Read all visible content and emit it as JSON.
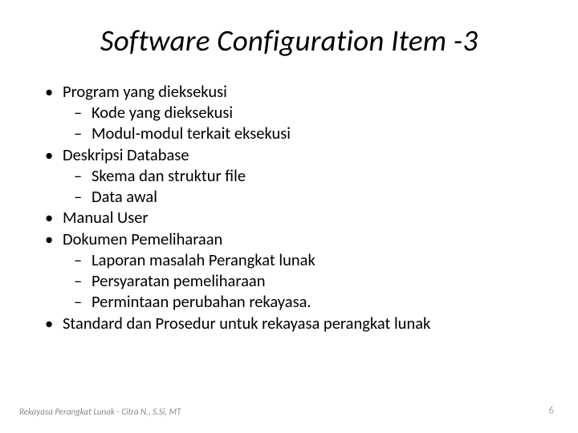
{
  "title": "Software Configuration Item -3",
  "items": [
    {
      "text": "Program yang dieksekusi",
      "sub": [
        "Kode yang dieksekusi",
        "Modul-modul terkait eksekusi"
      ]
    },
    {
      "text": "Deskripsi Database",
      "sub": [
        "Skema dan struktur file",
        "Data awal"
      ]
    },
    {
      "text": "Manual User",
      "sub": []
    },
    {
      "text": "Dokumen Pemeliharaan",
      "sub": [
        "Laporan masalah Perangkat lunak",
        "Persyaratan pemeliharaan",
        "Permintaan perubahan rekayasa."
      ]
    },
    {
      "text": "Standard dan Prosedur untuk rekayasa perangkat lunak",
      "sub": []
    }
  ],
  "footer": {
    "left": "Rekayasa Perangkat Lunak - Citra N., S.Si, MT",
    "page": "6"
  }
}
